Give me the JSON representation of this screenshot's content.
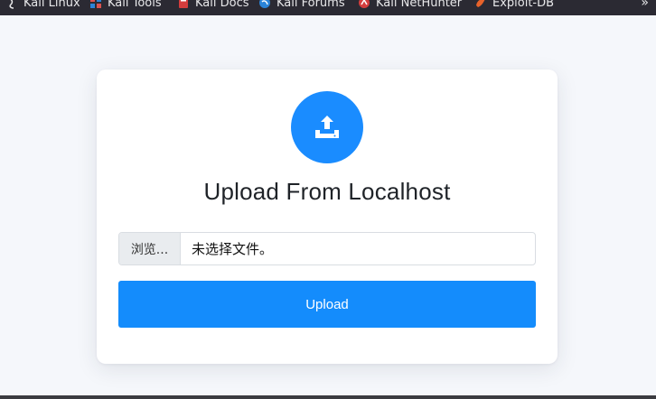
{
  "bookmarks": [
    {
      "label": "Kali Linux",
      "icon": "kali-dragon-icon",
      "color": "#e8e8ea"
    },
    {
      "label": "Kali Tools",
      "icon": "kali-tools-icon",
      "color": "#d9534f"
    },
    {
      "label": "Kali Docs",
      "icon": "kali-docs-icon",
      "color": "#d43d3d"
    },
    {
      "label": "Kali Forums",
      "icon": "kali-forums-icon",
      "color": "#2b84d8"
    },
    {
      "label": "Kali NetHunter",
      "icon": "nethunter-icon",
      "color": "#d43d3d"
    },
    {
      "label": "Exploit-DB",
      "icon": "exploit-db-icon",
      "color": "#e8622a"
    }
  ],
  "bookmarks_overflow": "»",
  "card": {
    "icon": "upload-icon",
    "title": "Upload From Localhost",
    "file_input": {
      "browse_label": "浏览...",
      "status_text": "未选择文件。"
    },
    "upload_label": "Upload"
  },
  "colors": {
    "accent": "#148cfc",
    "circle": "#1a8cff",
    "bookmarks_bar_bg": "#2b2a33",
    "page_bg": "#f5f7fb"
  }
}
